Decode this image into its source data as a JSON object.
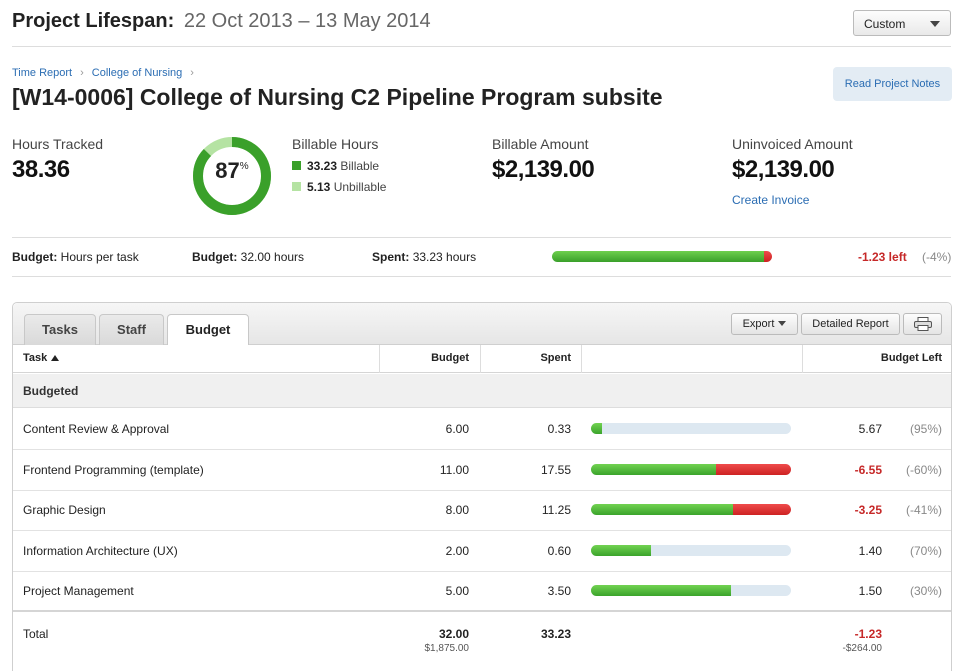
{
  "header": {
    "lifespan_label": "Project Lifespan:",
    "lifespan_dates": "22 Oct 2013 – 13 May 2014",
    "range_select": "Custom"
  },
  "breadcrumb": [
    "Time Report",
    "College of Nursing"
  ],
  "project_title": "[W14-0006] College of Nursing C2 Pipeline Program subsite",
  "notes_button": "Read Project Notes",
  "stats": {
    "hours_label": "Hours Tracked",
    "hours_value": "38.36",
    "billable_percent": "87",
    "billable_percent_unit": "%",
    "billable_fraction": 0.87,
    "billable_label": "Billable Hours",
    "billable_hours": "33.23",
    "billable_text": "Billable",
    "unbillable_hours": "5.13",
    "unbillable_text": "Unbillable",
    "amount_label": "Billable Amount",
    "amount_value": "$2,139.00",
    "uninvoiced_label": "Uninvoiced Amount",
    "uninvoiced_value": "$2,139.00",
    "create_invoice": "Create Invoice"
  },
  "budget_summary": {
    "type_label": "Budget:",
    "type_value": "Hours per task",
    "budget_label": "Budget:",
    "budget_value": "32.00 hours",
    "spent_label": "Spent:",
    "spent_value": "33.23 hours",
    "left": "-1.23 left",
    "left_pct": "(-4%)",
    "green_fraction": 0.963,
    "red_fraction": 0.037
  },
  "tabs": [
    "Tasks",
    "Staff",
    "Budget"
  ],
  "toolbar": {
    "export": "Export",
    "detailed_report": "Detailed Report"
  },
  "table": {
    "headers": {
      "task": "Task",
      "budget": "Budget",
      "spent": "Spent",
      "left": "Budget Left"
    },
    "group": "Budgeted",
    "rows": [
      {
        "task": "Content Review & Approval",
        "budget": "6.00",
        "spent": "0.33",
        "left": "5.67",
        "pct": "(95%)",
        "negative": false,
        "green": 0.055,
        "red": 0
      },
      {
        "task": "Frontend Programming (template)",
        "budget": "11.00",
        "spent": "17.55",
        "left": "-6.55",
        "pct": "(-60%)",
        "negative": true,
        "green": 0.627,
        "red": 0.373
      },
      {
        "task": "Graphic Design",
        "budget": "8.00",
        "spent": "11.25",
        "left": "-3.25",
        "pct": "(-41%)",
        "negative": true,
        "green": 0.711,
        "red": 0.289
      },
      {
        "task": "Information Architecture (UX)",
        "budget": "2.00",
        "spent": "0.60",
        "left": "1.40",
        "pct": "(70%)",
        "negative": false,
        "green": 0.3,
        "red": 0
      },
      {
        "task": "Project Management",
        "budget": "5.00",
        "spent": "3.50",
        "left": "1.50",
        "pct": "(30%)",
        "negative": false,
        "green": 0.7,
        "red": 0
      }
    ],
    "total": {
      "label": "Total",
      "budget": "32.00",
      "budget_amount": "$1,875.00",
      "spent": "33.23",
      "left": "-1.23",
      "left_amount": "-$264.00"
    }
  },
  "colors": {
    "link": "#2b6db3",
    "green": "#3aa02a",
    "light_green": "#b5e3a3",
    "red": "#c62828"
  }
}
